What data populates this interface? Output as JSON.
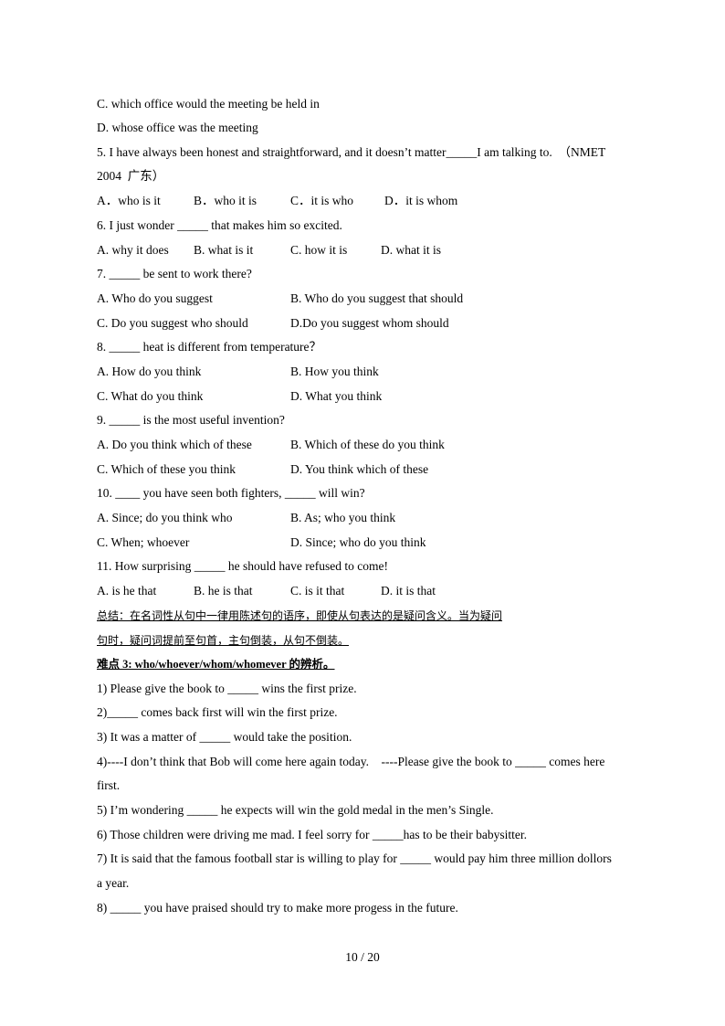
{
  "lines": {
    "l1": "C. which office would the meeting be held in",
    "l2": "D. whose office was the meeting",
    "q5a": "5. I have always been honest and straightforward, and it doesn’t matter_____I am talking to.  （NMET",
    "q5b": "2004  广东）",
    "q5opts": [
      "A．who is it",
      "B．who it is",
      "C．it is who",
      "D．it is whom"
    ],
    "q6": "6. I just wonder _____ that makes him so excited.",
    "q6opts": [
      "A. why it does",
      "B. what is it",
      "C. how it is",
      "D. what it is"
    ],
    "q7": "7. _____ be sent to work there?",
    "q7opts": [
      "A. Who do you suggest",
      "B. Who do you suggest that should",
      "C. Do you suggest who should",
      "D.Do you suggest whom should"
    ],
    "q8": "8. _____ heat is different from temperature？",
    "q8opts": [
      "A. How do you think",
      "B. How you think",
      "C. What do you think",
      "D. What you think"
    ],
    "q9": "9. _____ is the most useful invention?",
    "q9opts": [
      "A. Do you think which of these",
      "B. Which of these do you think",
      "C. Which of these you think",
      "D. You think which of these"
    ],
    "q10": "10. ____ you have seen both fighters, _____ will win?",
    "q10opts": [
      "A. Since; do you think who",
      "B. As; who you think",
      "C. When; whoever",
      "D. Since; who do you think"
    ],
    "q11": "11. How surprising _____ he should have refused to come!",
    "q11opts": [
      "A. is he that",
      "B. he is that",
      "C. is it that",
      "D. it is that"
    ],
    "summary1": "总结：在名词性从句中一律用陈述句的语序，即使从句表达的是疑问含义。当为疑问",
    "summary2": "句时，疑问词提前至句首，主句倒装，从句不倒装。",
    "heading3": "难点 3: who/whoever/whom/whomever 的辨析。",
    "e1": "1) Please give the book to _____ wins the first prize.",
    "e2": "2)_____ comes back first will win the first prize.",
    "e3": "3) It was a matter of _____ would take the position.",
    "e4a": "4)----I don’t think that Bob will come here again today.    ----Please give the book to _____ comes here",
    "e4b": "first.",
    "e5": "5) I’m wondering _____ he expects will win the gold medal in the men’s Single.",
    "e6": "6) Those children were driving me mad. I feel sorry for _____has to be their babysitter.",
    "e7a": "7) It is said that the famous football star is willing to play for _____ would pay him three million dollors",
    "e7b": "a year.",
    "e8": "8) _____ you have praised should try to make more progess in the future."
  },
  "footer": {
    "page": "10  /  20"
  }
}
